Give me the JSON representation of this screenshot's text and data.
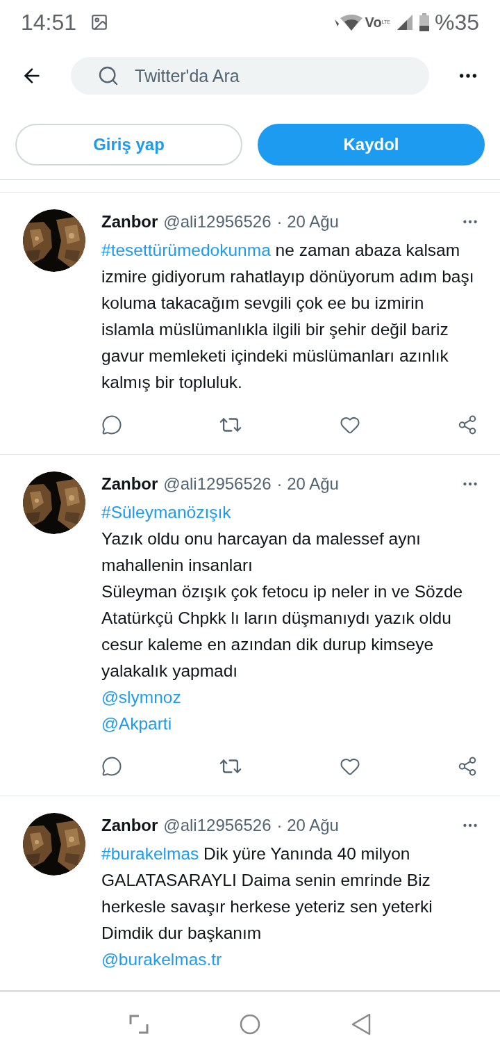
{
  "status_bar": {
    "time": "14:51",
    "network": "Vo",
    "network_sub": "LTE",
    "battery": "%35"
  },
  "header": {
    "search": {
      "placeholder": "Twitter'da Ara"
    }
  },
  "auth_buttons": [
    {
      "label": "Giriş yap",
      "kind": "outline"
    },
    {
      "label": "Kaydol",
      "kind": "primary"
    }
  ],
  "tweets": [
    {
      "name": "Zanbor",
      "handle": "@ali12956526",
      "time": "· 20 Ağu",
      "actions_visible": true,
      "paragraphs": [
        [
          {
            "kind": "hashtag",
            "text": "#tesettürümedokunma"
          },
          {
            "kind": "text",
            "text": " ne zaman abaza kalsam izmire gidiyorum rahatlayıp dönüyorum adım başı koluma takacağım sevgili çok ee bu izmirin islamla müslümanlıkla ilgili bir şehir değil bariz gavur memleketi içindeki müslümanları azınlık kalmış bir topluluk."
          }
        ]
      ]
    },
    {
      "name": "Zanbor",
      "handle": "@ali12956526",
      "time": "· 20 Ağu",
      "actions_visible": true,
      "paragraphs": [
        [
          {
            "kind": "hashtag",
            "text": "#Süleymanözışık"
          }
        ],
        [
          {
            "kind": "text",
            "text": "Yazık oldu onu harcayan da malessef aynı mahallenin insanları"
          }
        ],
        [
          {
            "kind": "text",
            "text": "Süleyman özışık çok fetocu ip neler in ve Sözde Atatürkçü Chpkk lı ların düşmanıydı yazık oldu cesur kaleme en azından dik durup kimseye yalakalık yapmadı"
          }
        ],
        [
          {
            "kind": "mention",
            "text": "@slymnoz"
          }
        ],
        [
          {
            "kind": "mention",
            "text": "@Akparti"
          }
        ]
      ]
    },
    {
      "name": "Zanbor",
      "handle": "@ali12956526",
      "time": "· 20 Ağu",
      "actions_visible": false,
      "paragraphs": [
        [
          {
            "kind": "hashtag",
            "text": "#burakelmas"
          },
          {
            "kind": "text",
            "text": " Dik yüre Yanında 40 milyon GALATASARAYLI Daima senin emrinde Biz herkesle savaşır herkese yeteriz sen yeterki Dimdik dur başkanım"
          }
        ],
        [
          {
            "kind": "mention",
            "text": "@burakelmas.tr"
          }
        ]
      ]
    }
  ]
}
